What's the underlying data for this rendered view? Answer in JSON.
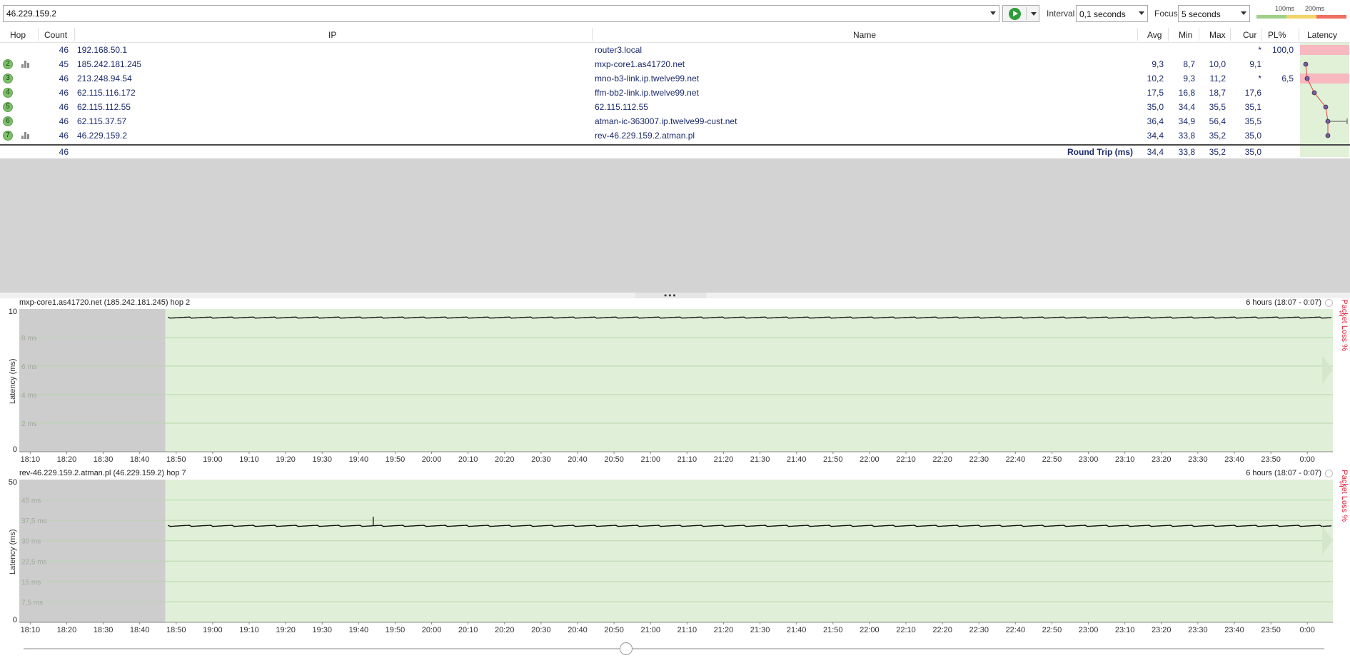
{
  "toolbar": {
    "target": "46.229.159.2",
    "interval_label": "Interval",
    "interval_value": "0,1 seconds",
    "focus_label": "Focus",
    "focus_value": "5 seconds",
    "legend_100": "100ms",
    "legend_200": "200ms"
  },
  "table": {
    "headers": {
      "hop": "Hop",
      "count": "Count",
      "ip": "IP",
      "name": "Name",
      "avg": "Avg",
      "min": "Min",
      "max": "Max",
      "cur": "Cur",
      "pl": "PL%",
      "latency": "Latency"
    },
    "rows": [
      {
        "hop": "",
        "count": "46",
        "ip": "192.168.50.1",
        "name": "router3.local",
        "avg": "",
        "min": "",
        "max": "",
        "cur": "*",
        "pl": "100,0",
        "graph": false
      },
      {
        "hop": "2",
        "count": "45",
        "ip": "185.242.181.245",
        "name": "mxp-core1.as41720.net",
        "avg": "9,3",
        "min": "8,7",
        "max": "10,0",
        "cur": "9,1",
        "pl": "",
        "graph": true
      },
      {
        "hop": "3",
        "count": "46",
        "ip": "213.248.94.54",
        "name": "mno-b3-link.ip.twelve99.net",
        "avg": "10,2",
        "min": "9,3",
        "max": "11,2",
        "cur": "*",
        "pl": "6,5",
        "graph": false
      },
      {
        "hop": "4",
        "count": "46",
        "ip": "62.115.116.172",
        "name": "ffm-bb2-link.ip.twelve99.net",
        "avg": "17,5",
        "min": "16,8",
        "max": "18,7",
        "cur": "17,6",
        "pl": "",
        "graph": false
      },
      {
        "hop": "5",
        "count": "46",
        "ip": "62.115.112.55",
        "name": "62.115.112.55",
        "avg": "35,0",
        "min": "34,4",
        "max": "35,5",
        "cur": "35,1",
        "pl": "",
        "graph": false
      },
      {
        "hop": "6",
        "count": "46",
        "ip": "62.115.37.57",
        "name": "atman-ic-363007.ip.twelve99-cust.net",
        "avg": "36,4",
        "min": "34,9",
        "max": "56,4",
        "cur": "35,5",
        "pl": "",
        "graph": false
      },
      {
        "hop": "7",
        "count": "46",
        "ip": "46.229.159.2",
        "name": "rev-46.229.159.2.atman.pl",
        "avg": "34,4",
        "min": "33,8",
        "max": "35,2",
        "cur": "35,0",
        "pl": "",
        "graph": true
      }
    ],
    "roundtrip": {
      "count": "46",
      "label": "Round Trip (ms)",
      "avg": "34,4",
      "min": "33,8",
      "max": "35,2",
      "cur": "35,0"
    }
  },
  "colors": {
    "loss": "#f7b8bf",
    "ok": "#e0f1d7",
    "accent_green": "#2e9e3a",
    "packet_loss": "#e8213b"
  },
  "chart_data": [
    {
      "type": "line",
      "title": "mxp-core1.as41720.net (185.242.181.245) hop 2",
      "range": "6 hours (18:07 - 0:07)",
      "ylabel": "Latency (ms)",
      "y2label": "Packet Loss %",
      "y2max": "1",
      "ylim": [
        0,
        10
      ],
      "ytick_labels": [
        "10",
        "8 ms",
        "6 ms",
        "4 ms",
        "2 ms",
        "0"
      ],
      "xticks": [
        "18:10",
        "18:20",
        "18:30",
        "18:40",
        "18:50",
        "19:00",
        "19:10",
        "19:20",
        "19:30",
        "19:40",
        "19:50",
        "20:00",
        "20:10",
        "20:20",
        "20:30",
        "20:40",
        "20:50",
        "21:00",
        "21:10",
        "21:20",
        "21:30",
        "21:40",
        "21:50",
        "22:00",
        "22:10",
        "22:20",
        "22:30",
        "22:40",
        "22:50",
        "23:00",
        "23:10",
        "23:20",
        "23:30",
        "23:40",
        "23:50",
        "0:00"
      ],
      "no_data_until": "18:47",
      "series": [
        {
          "values": [
            9.4,
            9.4,
            9.4,
            9.4,
            9.4,
            9.4,
            9.4,
            9.4,
            9.4,
            9.4,
            9.4,
            9.4,
            9.4,
            9.4,
            9.4,
            9.4,
            9.4,
            9.4,
            9.4,
            9.4,
            9.4,
            9.4,
            9.4,
            9.4,
            9.4,
            9.4,
            9.4,
            9.4,
            9.4,
            9.4,
            9.4,
            9.4,
            9.4,
            9.4
          ],
          "spike_at": null
        }
      ]
    },
    {
      "type": "line",
      "title": "rev-46.229.159.2.atman.pl (46.229.159.2) hop 7",
      "range": "6 hours (18:07 - 0:07)",
      "ylabel": "Latency (ms)",
      "y2label": "Packet Loss %",
      "y2max": "1",
      "ylim": [
        0,
        50
      ],
      "ytick_labels": [
        "50",
        "45 ms",
        "37,5 ms",
        "30 ms",
        "22,5 ms",
        "15 ms",
        "7,5 ms",
        "0"
      ],
      "xticks": [
        "18:10",
        "18:20",
        "18:30",
        "18:40",
        "18:50",
        "19:00",
        "19:10",
        "19:20",
        "19:30",
        "19:40",
        "19:50",
        "20:00",
        "20:10",
        "20:20",
        "20:30",
        "20:40",
        "20:50",
        "21:00",
        "21:10",
        "21:20",
        "21:30",
        "21:40",
        "21:50",
        "22:00",
        "22:10",
        "22:20",
        "22:30",
        "22:40",
        "22:50",
        "23:00",
        "23:10",
        "23:20",
        "23:30",
        "23:40",
        "23:50",
        "0:00"
      ],
      "no_data_until": "18:47",
      "series": [
        {
          "values": [
            33.8,
            33.8,
            33.8,
            33.8,
            33.8,
            33.8,
            33.8,
            33.8,
            33.8,
            33.8,
            33.8,
            33.8,
            33.8,
            33.8,
            33.8,
            33.8,
            33.8,
            33.8,
            33.8,
            33.8,
            33.8,
            33.8,
            33.8,
            33.8,
            33.8,
            33.8,
            33.8,
            33.8,
            33.8,
            33.8,
            33.8,
            33.8,
            33.8,
            33.8
          ],
          "spike_at": "19:44",
          "spike_value": 37
        }
      ]
    }
  ]
}
